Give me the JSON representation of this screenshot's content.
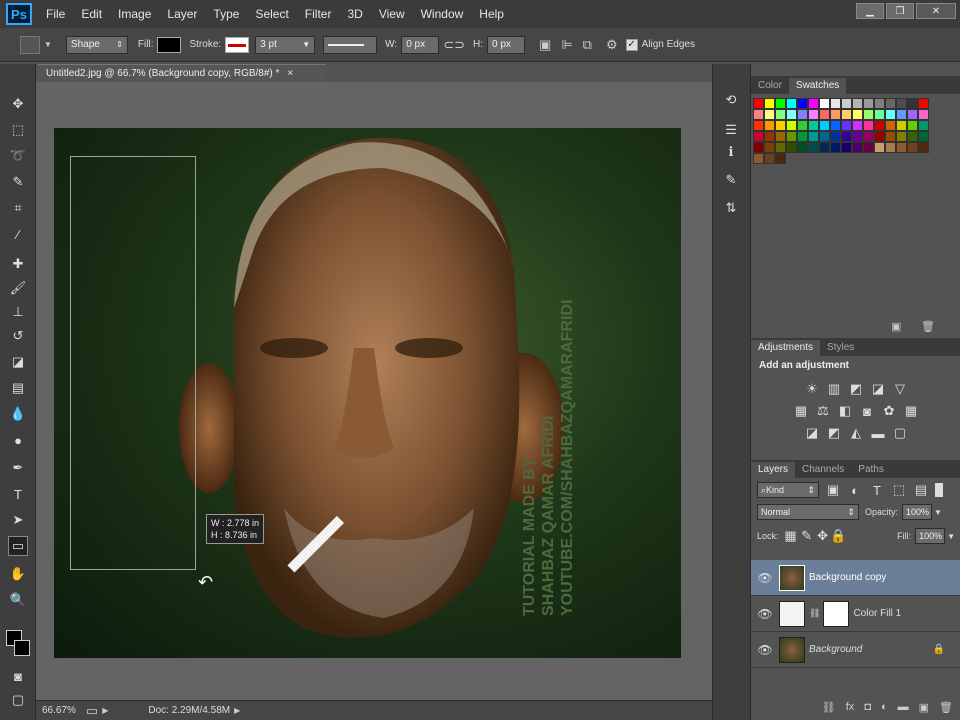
{
  "menubar": {
    "logo": "Ps",
    "items": [
      "File",
      "Edit",
      "Image",
      "Layer",
      "Type",
      "Select",
      "Filter",
      "3D",
      "View",
      "Window",
      "Help"
    ],
    "win_min": "▁",
    "win_restore": "❐",
    "win_close": "✕"
  },
  "options": {
    "mode": "Shape",
    "fill_label": "Fill:",
    "stroke_label": "Stroke:",
    "stroke_width": "3 pt",
    "w_label": "W:",
    "w_value": "0 px",
    "h_label": "H:",
    "h_value": "0 px",
    "align_edges": "Align Edges"
  },
  "document": {
    "tab_title": "Untitled2.jpg @ 66.7% (Background copy, RGB/8#) *",
    "tab_close": "×",
    "watermark_1": "TUTORIAL MADE BY :",
    "watermark_2": "SHAHBAZ QAMAR AFRIDI",
    "watermark_3": "YOUTUBE.COM/SHAHBAZQAMARAFRIDI",
    "readout_w": "W :   2.778 in",
    "readout_h": "H :   8.736 in"
  },
  "status": {
    "zoom": "66.67%",
    "doc": "Doc: 2.29M/4.58M"
  },
  "color_panel": {
    "tab_color": "Color",
    "tab_swatches": "Swatches"
  },
  "swatches": [
    "#ff0000",
    "#ffff00",
    "#00ff00",
    "#00ffff",
    "#0000ff",
    "#ff00ff",
    "#ffffff",
    "#e6e6e6",
    "#cccccc",
    "#b3b3b3",
    "#999999",
    "#808080",
    "#666666",
    "#4d4d4d",
    "#333333",
    "#ff0000",
    "#ff8080",
    "#ffff80",
    "#80ff80",
    "#80ffff",
    "#8080ff",
    "#ff80ff",
    "#ff6666",
    "#ff9966",
    "#ffcc66",
    "#ffff66",
    "#99ff66",
    "#66ff99",
    "#66ffff",
    "#6699ff",
    "#9966ff",
    "#ff66cc",
    "#ff3300",
    "#ff9900",
    "#ffcc00",
    "#ccff00",
    "#33cc33",
    "#00cc99",
    "#00ccff",
    "#0066ff",
    "#6633ff",
    "#cc33ff",
    "#ff3399",
    "#cc0000",
    "#cc6600",
    "#cccc00",
    "#66cc00",
    "#009966",
    "#cc0033",
    "#993300",
    "#996600",
    "#669900",
    "#009933",
    "#009999",
    "#006699",
    "#003399",
    "#330099",
    "#660099",
    "#990066",
    "#990000",
    "#994d00",
    "#808000",
    "#336600",
    "#006633",
    "#800000",
    "#804000",
    "#666600",
    "#334d00",
    "#004d26",
    "#004d4d",
    "#002d4d",
    "#001a66",
    "#1a0066",
    "#4d0066",
    "#66004d",
    "#c8a070",
    "#a87a50",
    "#8c5c30",
    "#704020",
    "#502810",
    "#8c5a30",
    "#6a4020",
    "#4a2810"
  ],
  "adjustments": {
    "tab_adjustments": "Adjustments",
    "tab_styles": "Styles",
    "heading": "Add an adjustment"
  },
  "layers": {
    "tab_layers": "Layers",
    "tab_channels": "Channels",
    "tab_paths": "Paths",
    "kind": "Kind",
    "blend_mode": "Normal",
    "opacity_label": "Opacity:",
    "opacity_value": "100%",
    "lock_label": "Lock:",
    "fill_label": "Fill:",
    "fill_value": "100%",
    "items": [
      {
        "name": "Background copy"
      },
      {
        "name": "Color Fill 1"
      },
      {
        "name": "Background"
      }
    ]
  },
  "colors": {
    "accent": "#31a8ff",
    "selected_layer": "#6b7f99"
  }
}
